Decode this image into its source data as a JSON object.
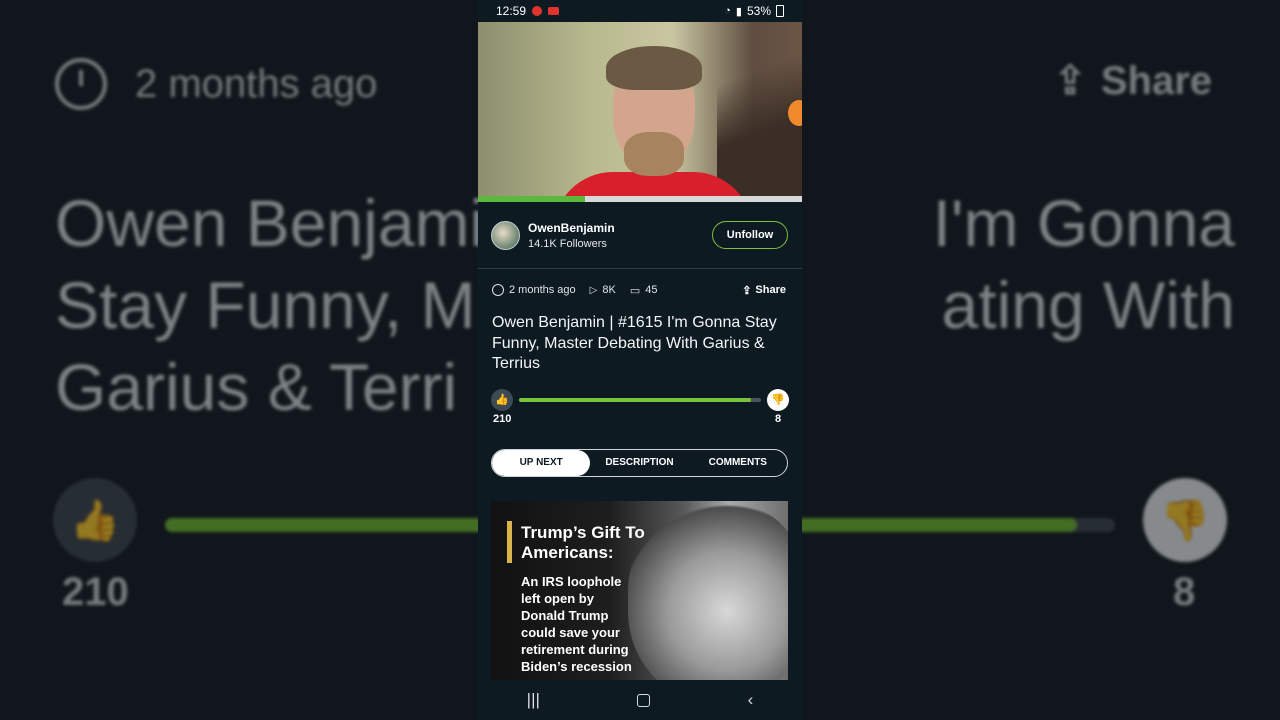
{
  "status_bar": {
    "time": "12:59",
    "battery": "53%"
  },
  "channel": {
    "name": "OwenBenjamin",
    "followers": "14.1K Followers",
    "follow_button": "Unfollow"
  },
  "meta": {
    "posted": "2 months ago",
    "views": "8K",
    "comments": "45",
    "share_label": "Share"
  },
  "video": {
    "title": "Owen Benjamin | #1615 I'm Gonna Stay Funny, Master Debating With Garius & Terrius",
    "playback_progress": 0.33
  },
  "rating": {
    "likes": "210",
    "dislikes": "8",
    "like_fraction": 0.96
  },
  "tabs": [
    {
      "label": "UP NEXT",
      "active": true
    },
    {
      "label": "DESCRIPTION",
      "active": false
    },
    {
      "label": "COMMENTS",
      "active": false
    }
  ],
  "ad": {
    "headline": "Trump’s Gift To Americans:",
    "body": "An IRS loophole left open by Donald Trump could save your retirement during Biden’s recession"
  },
  "background": {
    "posted": "2 months ago",
    "share_label": "Share",
    "title_fragment_1": "Owen Benjami",
    "title_fragment_2": "I'm Gonna",
    "title_fragment_3": "Stay Funny, M",
    "title_fragment_4": "ating With",
    "title_fragment_5": "Garius & Terri",
    "likes": "210",
    "dislikes": "8"
  },
  "colors": {
    "accent_green": "#79c33a",
    "app_bg": "#0e1a22"
  },
  "icons": [
    "clock-icon",
    "play-icon",
    "comment-icon",
    "share-icon",
    "thumbs-up-icon",
    "thumbs-down-icon",
    "recents-icon",
    "home-icon",
    "back-icon"
  ]
}
